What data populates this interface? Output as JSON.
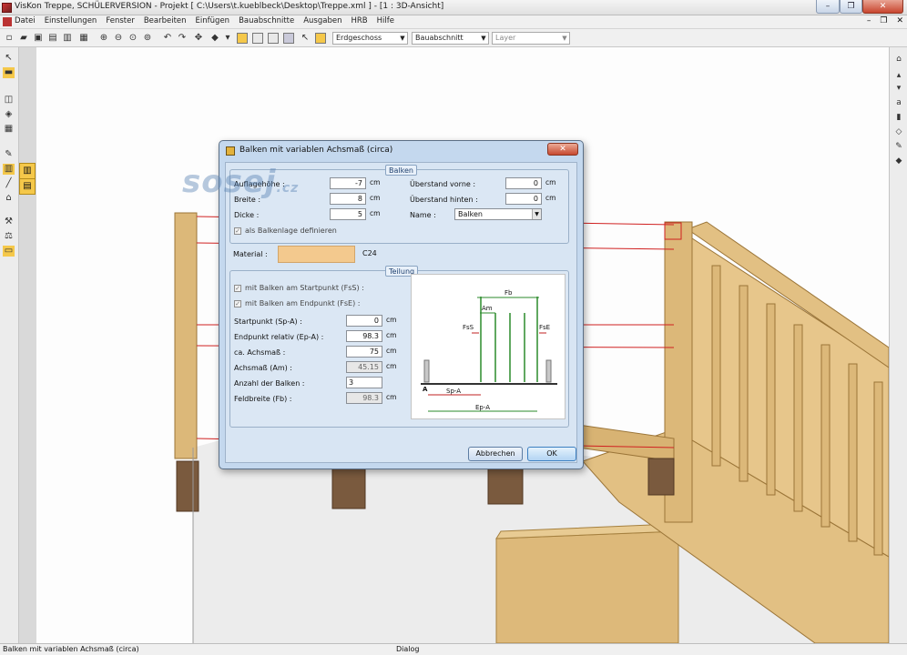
{
  "window": {
    "title": "VisKon Treppe, SCHÜLERVERSION - Projekt [ C:\\Users\\t.kueblbeck\\Desktop\\Treppe.xml ] - [1 : 3D-Ansicht]",
    "min": "–",
    "max": "❐",
    "close": "✕"
  },
  "menu": {
    "items": [
      "Datei",
      "Einstellungen",
      "Fenster",
      "Bearbeiten",
      "Einfügen",
      "Bauabschnitte",
      "Ausgaben",
      "HRB",
      "Hilfe"
    ],
    "mdi": [
      "–",
      "❐",
      "✕"
    ]
  },
  "toolbar": {
    "combo_floor": "Erdgeschoss",
    "combo_section": "Bauabschnitt",
    "combo_layer": "Layer"
  },
  "dialog": {
    "title": "Balken mit variablen Achsmaß (circa)",
    "close": "✕",
    "balken": {
      "legend": "Balken",
      "auflagehoehe_label": "Auflagehöhe :",
      "auflagehoehe_value": "-7",
      "auflagehoehe_unit": "cm",
      "breite_label": "Breite :",
      "breite_value": "8",
      "breite_unit": "cm",
      "dicke_label": "Dicke :",
      "dicke_value": "5",
      "dicke_unit": "cm",
      "ueberstand_vorne_label": "Überstand vorne :",
      "ueberstand_vorne_value": "0",
      "ueberstand_vorne_unit": "cm",
      "ueberstand_hinten_label": "Überstand hinten :",
      "ueberstand_hinten_value": "0",
      "ueberstand_hinten_unit": "cm",
      "name_label": "Name :",
      "name_value": "Balken",
      "balkenlage_label": "als Balkenlage definieren",
      "balkenlage_checked": "✓"
    },
    "material": {
      "label": "Material :",
      "value": "C24"
    },
    "teilung": {
      "legend": "Teilung",
      "start_chk_label": "mit Balken am Startpunkt (FsS) :",
      "end_chk_label": "mit Balken am Endpunkt (FsE) :",
      "checked": "✓",
      "startpunkt_label": "Startpunkt  (Sp-A) :",
      "startpunkt_value": "0",
      "startpunkt_unit": "cm",
      "endpunkt_label": "Endpunkt relativ  (Ep-A) :",
      "endpunkt_value": "98.3",
      "endpunkt_unit": "cm",
      "achsmass_ca_label": "ca. Achsmaß :",
      "achsmass_ca_value": "75",
      "achsmass_ca_unit": "cm",
      "achsmass_label": "Achsmaß (Am) :",
      "achsmass_value": "45.15",
      "achsmass_unit": "cm",
      "anzahl_label": "Anzahl der Balken :",
      "anzahl_value": "3",
      "feldbreite_label": "Feldbreite (Fb) :",
      "feldbreite_value": "98.3",
      "feldbreite_unit": "cm"
    },
    "diagram": {
      "fb": "Fb",
      "am": "Am",
      "fss": "FsS",
      "fse": "FsE",
      "sp_a": "Sp-A",
      "ep_a": "Ep-A",
      "a": "A"
    },
    "buttons": {
      "cancel": "Abbrechen",
      "ok": "OK"
    }
  },
  "watermark": {
    "text": "sosej",
    "suffix": ".cz"
  },
  "status": {
    "left": "Balken mit variablen Achsmaß (circa)",
    "mid": "Dialog"
  },
  "colors": {
    "accent": "#f5c84a",
    "wood": "#e2c083",
    "dialog_bg": "#d8e5f3"
  }
}
